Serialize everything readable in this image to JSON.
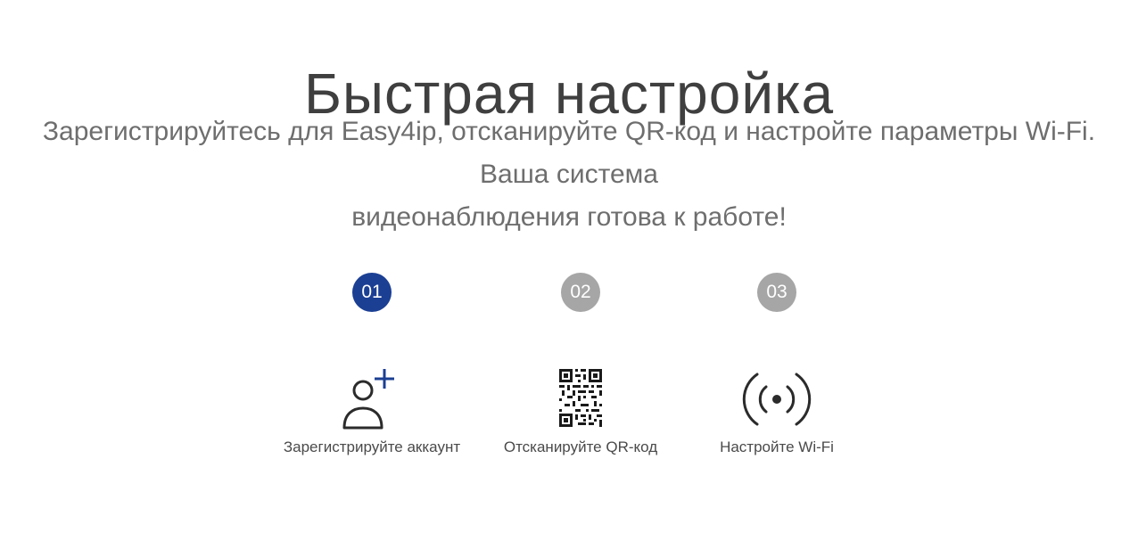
{
  "header": {
    "title": "Быстрая настройка",
    "subtitle_line1": "Зарегистрируйтесь для Easy4ip, отсканируйте QR-код и настройте параметры Wi-Fi. Ваша система",
    "subtitle_line2": "видеонаблюдения готова к работе!"
  },
  "steps": [
    {
      "number": "01",
      "label": "Зарегистрируйте аккаунт",
      "icon": "add-user-icon",
      "state": "active"
    },
    {
      "number": "02",
      "label": "Отсканируйте QR-код",
      "icon": "qr-code-icon",
      "state": "inactive"
    },
    {
      "number": "03",
      "label": "Настройте Wi-Fi",
      "icon": "wifi-broadcast-icon",
      "state": "inactive"
    }
  ],
  "colors": {
    "active_step": "#1b3f93",
    "inactive_step": "#a6a6a6",
    "accent_plus": "#1b3f93"
  }
}
